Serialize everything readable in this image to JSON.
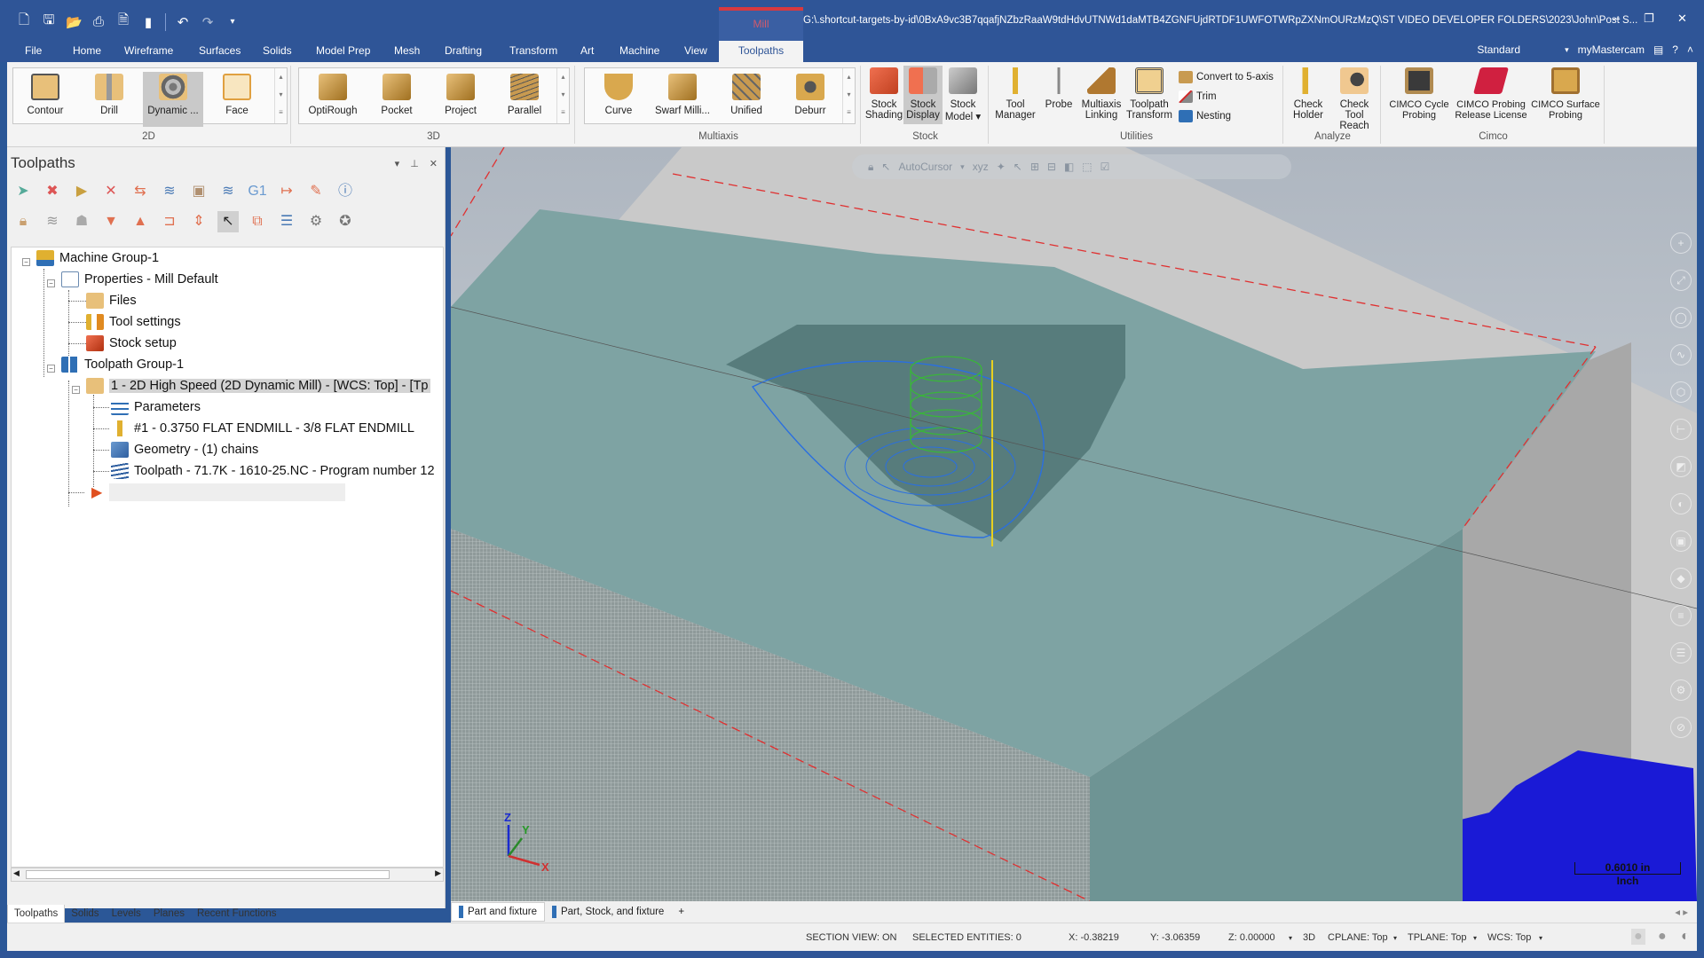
{
  "titlebar": {
    "qat_icons": [
      "new-file-icon",
      "save-icon",
      "open-icon",
      "print-icon",
      "save-as-icon",
      "merge-icon",
      "undo-icon",
      "redo-icon",
      "customize-icon"
    ],
    "mill_tab": "Mill",
    "file_path": "G:\\.shortcut-targets-by-id\\0BxA9vc3B7qqafjNZbzRaaW9tdHdvUTNWd1daMTB4ZGNFUjdRTDF1UWFOTWRpZXNmOURzMzQ\\ST VIDEO DEVELOPER FOLDERS\\2023\\John\\Post S...",
    "minimize": "‒",
    "restore": "❐",
    "close": "✕"
  },
  "menu": {
    "items": [
      "File",
      "Home",
      "Wireframe",
      "Surfaces",
      "Solids",
      "Model Prep",
      "Mesh",
      "Drafting",
      "Transform",
      "Art",
      "Machine",
      "View",
      "Toolpaths"
    ],
    "active": "Toolpaths",
    "workspace": "Standard",
    "account": "myMastercam"
  },
  "ribbon": {
    "groups": [
      {
        "label": "2D",
        "buttons": [
          "Contour",
          "Drill",
          "Dynamic ...",
          "Face"
        ],
        "selected": "Dynamic ..."
      },
      {
        "label": "3D",
        "buttons": [
          "OptiRough",
          "Pocket",
          "Project",
          "Parallel"
        ]
      },
      {
        "label": "Multiaxis",
        "buttons": [
          "Curve",
          "Swarf Milli...",
          "Unified",
          "Deburr"
        ]
      },
      {
        "label": "Stock",
        "buttons": [
          "Stock Shading",
          "Stock Display",
          "Stock Model ▾"
        ],
        "selected": "Stock Display"
      },
      {
        "label": "Utilities",
        "buttons": [
          "Tool Manager",
          "Probe",
          "Multiaxis Linking",
          "Toolpath Transform"
        ],
        "small": [
          "Convert to 5-axis",
          "Trim",
          "Nesting"
        ]
      },
      {
        "label": "Analyze",
        "buttons": [
          "Check Holder",
          "Check Tool Reach"
        ]
      },
      {
        "label": "Cimco",
        "buttons": [
          "CIMCO Cycle Probing",
          "CIMCO Probing Release License",
          "CIMCO Surface Probing"
        ]
      }
    ]
  },
  "panel": {
    "title": "Toolpaths",
    "tree": [
      {
        "label": "Machine Group-1",
        "level": 0
      },
      {
        "label": "Properties - Mill Default",
        "level": 1
      },
      {
        "label": "Files",
        "level": 2
      },
      {
        "label": "Tool settings",
        "level": 2
      },
      {
        "label": "Stock setup",
        "level": 2
      },
      {
        "label": "Toolpath Group-1",
        "level": 1
      },
      {
        "label": "1 - 2D High Speed (2D Dynamic Mill) - [WCS: Top] - [Tp",
        "level": 2,
        "selected": true
      },
      {
        "label": "Parameters",
        "level": 3
      },
      {
        "label": "#1 - 0.3750 FLAT ENDMILL - 3/8 FLAT ENDMILL",
        "level": 3
      },
      {
        "label": "Geometry - (1) chains",
        "level": 3
      },
      {
        "label": "Toolpath - 71.7K - 1610-25.NC - Program number 12",
        "level": 3
      }
    ],
    "tabs": [
      "Toolpaths",
      "Solids",
      "Levels",
      "Planes",
      "Recent Functions"
    ],
    "active_tab": "Toolpaths"
  },
  "viewport": {
    "autocursor_label": "AutoCursor",
    "scale_value": "0.6010 in",
    "scale_unit": "Inch",
    "axis_labels": {
      "x": "X",
      "y": "Y",
      "z": "Z"
    },
    "colors": {
      "part": "#6e9494",
      "fixture": "#1a1ad6",
      "toolpath": "#2a6fe0",
      "tool": "#3ab53a",
      "chain": "#e03030"
    }
  },
  "view_tabs": {
    "items": [
      "Part and fixture",
      "Part, Stock, and fixture"
    ],
    "active": "Part and fixture",
    "add": "+"
  },
  "status": {
    "section_view": "SECTION VIEW: ON",
    "selected": "SELECTED ENTITIES: 0",
    "x": "X:  -0.38219",
    "y": "Y:  -3.06359",
    "z": "Z:  0.00000",
    "mode": "3D",
    "cplane": "CPLANE: Top",
    "tplane": "TPLANE: Top",
    "wcs": "WCS: Top"
  }
}
